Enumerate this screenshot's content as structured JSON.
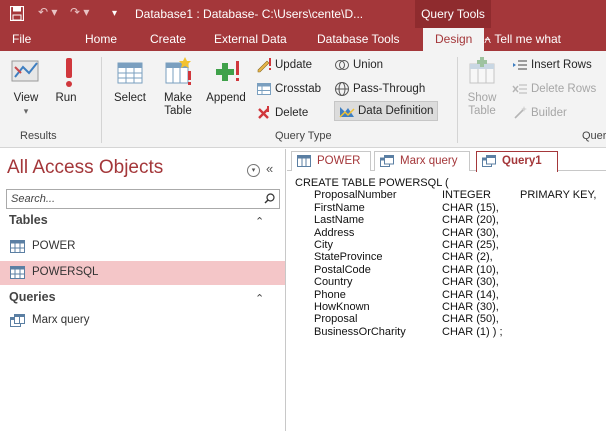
{
  "window": {
    "title": "Database1 : Database- C:\\Users\\cente\\D...",
    "context_tab": "Query Tools"
  },
  "ribbon_tabs": [
    "File",
    "Home",
    "Create",
    "External Data",
    "Database Tools",
    "Design"
  ],
  "active_tab": "Design",
  "tell_me": "Tell me what",
  "ribbon": {
    "results": {
      "label": "Results",
      "view": "View",
      "run": "Run"
    },
    "query_type": {
      "label": "Query Type",
      "select": "Select",
      "make_table": [
        "Make",
        "Table"
      ],
      "append": "Append",
      "update": "Update",
      "crosstab": "Crosstab",
      "delete": "Delete",
      "union": "Union",
      "pass_through": "Pass-Through",
      "data_definition": "Data Definition"
    },
    "query_setup": {
      "label": "Quer",
      "show_table": [
        "Show",
        "Table"
      ],
      "insert_rows": "Insert Rows",
      "delete_rows": "Delete Rows",
      "builder": "Builder"
    }
  },
  "nav": {
    "title": "All Access Objects",
    "search_placeholder": "Search...",
    "tables_header": "Tables",
    "tables": [
      "POWER",
      "POWERSQL"
    ],
    "selected_table": "POWERSQL",
    "queries_header": "Queries",
    "queries": [
      "Marx query"
    ]
  },
  "doc_tabs": [
    "POWER",
    "Marx query",
    "Query1"
  ],
  "active_doc_tab": "Query1",
  "sql": {
    "header": "CREATE TABLE POWERSQL (",
    "rows": [
      [
        "ProposalNumber",
        "INTEGER",
        "PRIMARY KEY,"
      ],
      [
        "FirstName",
        "CHAR (15),",
        ""
      ],
      [
        "LastName",
        "CHAR (20),",
        ""
      ],
      [
        "Address",
        "CHAR (30),",
        ""
      ],
      [
        "City",
        "CHAR (25),",
        ""
      ],
      [
        "StateProvince",
        "CHAR (2),",
        ""
      ],
      [
        "PostalCode",
        "CHAR (10),",
        ""
      ],
      [
        "Country",
        "CHAR (30),",
        ""
      ],
      [
        "Phone",
        "CHAR (14),",
        ""
      ],
      [
        "HowKnown",
        "CHAR (30),",
        ""
      ],
      [
        "Proposal",
        "CHAR (50),",
        ""
      ],
      [
        "BusinessOrCharity",
        "CHAR (1) ) ;",
        ""
      ]
    ]
  },
  "colors": {
    "brand": "#a4373a",
    "selection": "#f4c6c8",
    "ribbon_bg": "#f3f3f3"
  }
}
